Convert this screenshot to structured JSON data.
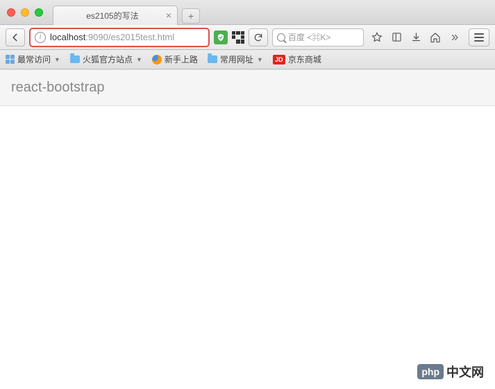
{
  "titlebar": {
    "tab_title": "es2105的写法"
  },
  "toolbar": {
    "url_host": "localhost",
    "url_rest": ":9090/es2015test.html",
    "search_placeholder": "百度 <⌘K>"
  },
  "bookmarks": {
    "most_visited": "最常访问",
    "firefox_site": "火狐官方站点",
    "getting_started": "新手上路",
    "common_urls": "常用网址",
    "jd": "京东商城",
    "jd_badge": "JD"
  },
  "content": {
    "panel_title": "react-bootstrap"
  },
  "watermark": {
    "badge": "php",
    "text": "中文网"
  }
}
